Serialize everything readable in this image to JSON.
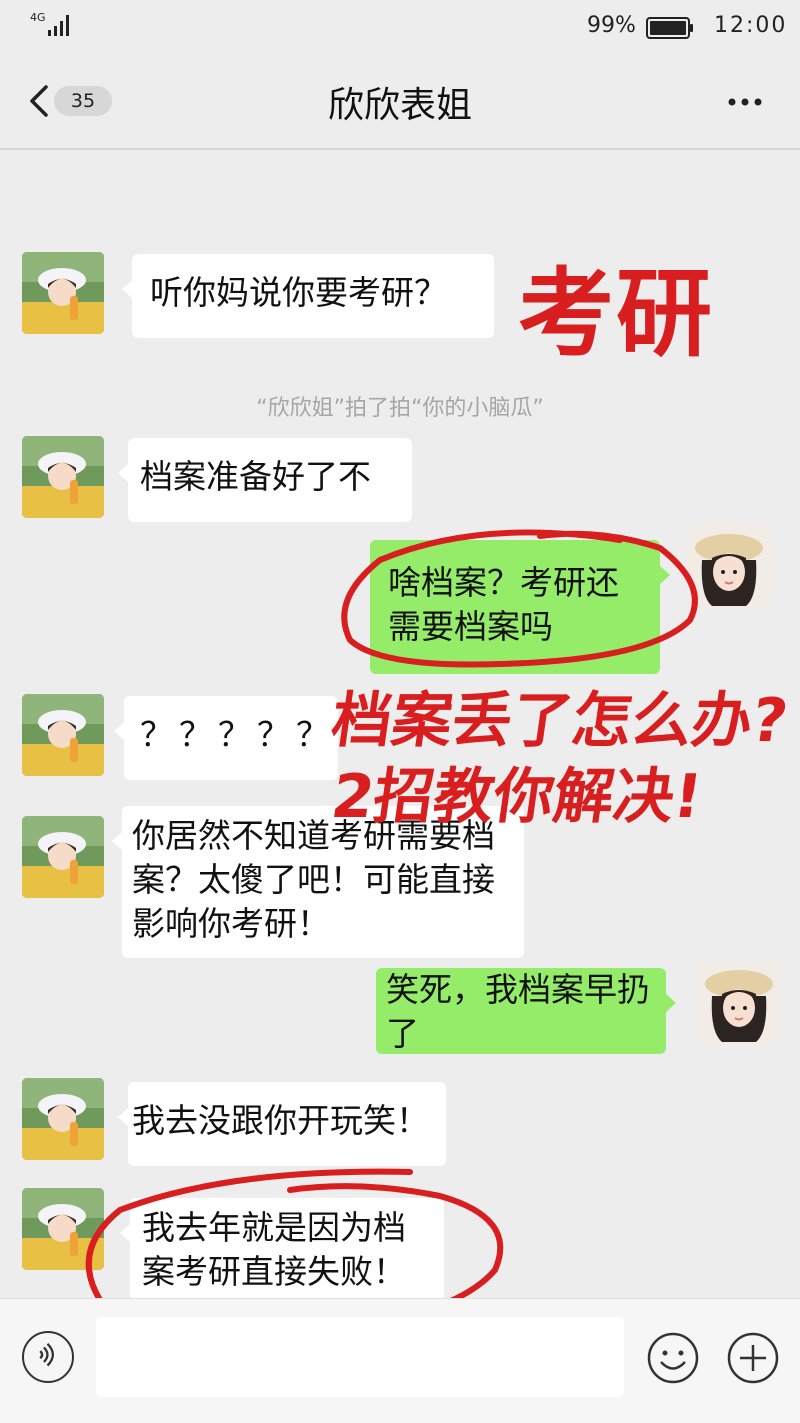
{
  "status_bar": {
    "network": "4G",
    "battery": "99%",
    "time": "12:00"
  },
  "header": {
    "unread_count": "35",
    "title": "欣欣表姐"
  },
  "system_message": "“欣欣姐”拍了拍“你的小脑瓜”",
  "messages": [
    {
      "side": "left",
      "text": "听你妈说你要考研？"
    },
    {
      "side": "left",
      "text": "档案准备好了不"
    },
    {
      "side": "right",
      "text": "啥档案？考研还需要档案吗"
    },
    {
      "side": "left",
      "text": "？？？？？"
    },
    {
      "side": "left",
      "text": "你居然不知道考研需要档案？太傻了吧！可能直接影响你考研！"
    },
    {
      "side": "right",
      "text": "笑死，我档案早扔了"
    },
    {
      "side": "left",
      "text": "我去没跟你开玩笑！"
    },
    {
      "side": "left",
      "text": "我去年就是因为档案考研直接失败！"
    }
  ],
  "overlay": {
    "headline": "考研",
    "line1": "档案丢了怎么办?",
    "line2": "2招教你解决!",
    "color": "#d81e1e"
  },
  "input": {
    "placeholder": ""
  },
  "icons": [
    "chevron-left-icon",
    "more-icon",
    "voice-icon",
    "emoji-icon",
    "plus-icon"
  ],
  "colors": {
    "background": "#ededed",
    "bubble_right": "#95ec69",
    "bubble_left": "#ffffff",
    "annotation_red": "#d81e1e"
  }
}
